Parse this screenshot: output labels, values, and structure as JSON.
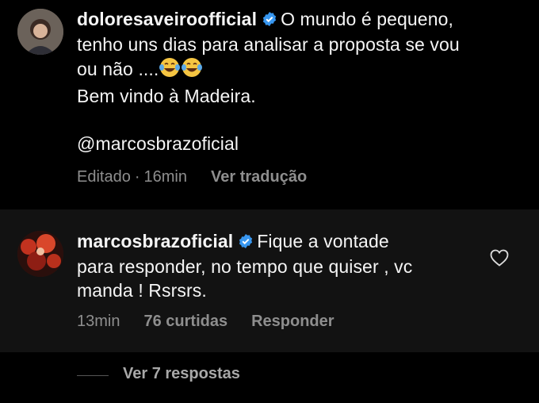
{
  "comment1": {
    "username": "doloresaveiroofficial",
    "line1": "O mundo é pequeno,",
    "line2": "tenho uns dias para analisar a proposta se vou",
    "line3": "ou não ....",
    "line4": "Bem vindo à Madeira.",
    "mention": "@marcosbrazoficial",
    "edited": "Editado",
    "time": "16min",
    "translate": "Ver tradução",
    "emoji_icon": "laughing-tears-icon"
  },
  "comment2": {
    "username": "marcosbrazoficial",
    "line1": "Fique a vontade",
    "line2": "para responder, no tempo que quiser , vc",
    "line3": "manda ! Rsrsrs.",
    "time": "13min",
    "likes": "76 curtidas",
    "reply": "Responder"
  },
  "replies": {
    "label": "Ver 7 respostas"
  },
  "colors": {
    "verified": "#3897f0",
    "muted": "#8e8e8e",
    "highlight_bg": "#121212"
  }
}
